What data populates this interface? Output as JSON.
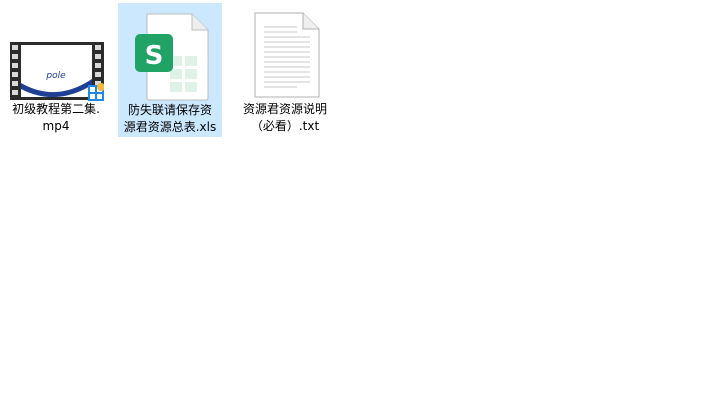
{
  "files": [
    {
      "name_line1": "初级教程第二集.",
      "name_line2": "mp4",
      "icon": "video-file-icon",
      "thumbnail_text": "pole",
      "selected": false
    },
    {
      "name_line1": "防失联请保存资",
      "name_line2": "源君资源总表.xls",
      "icon": "spreadsheet-file-icon",
      "app_letter": "S",
      "selected": true
    },
    {
      "name_line1": "资源君资源说明",
      "name_line2": "（必看）.txt",
      "icon": "text-file-icon",
      "selected": false
    }
  ],
  "colors": {
    "selection": "#cce8ff",
    "spreadsheet_green": "#21a366",
    "video_accent": "#1e88e5"
  }
}
